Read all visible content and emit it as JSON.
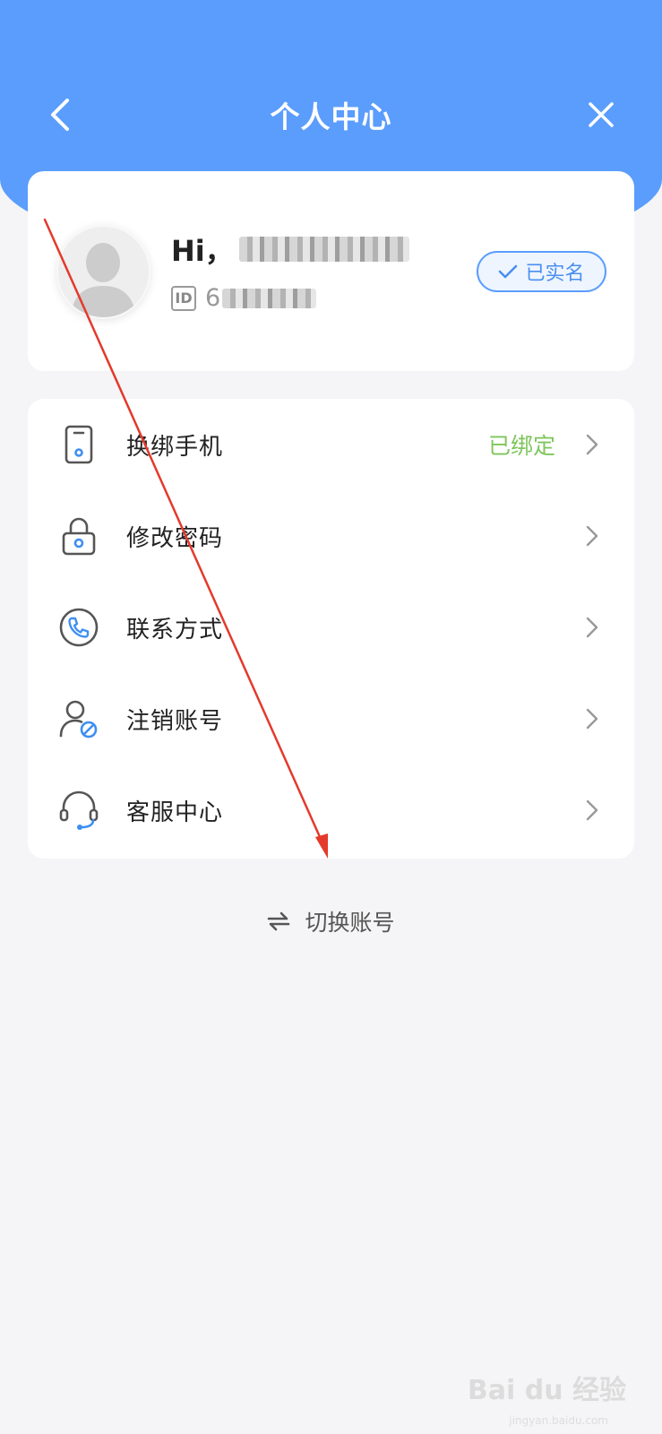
{
  "header": {
    "title": "个人中心",
    "background_color": "#5b9dfd"
  },
  "profile": {
    "greeting_prefix": "Hi，",
    "id_label": "ID",
    "id_value_visible": "6",
    "verified_label": "已实名"
  },
  "menu": {
    "items": [
      {
        "label": "换绑手机",
        "status": "已绑定",
        "icon": "phone-icon"
      },
      {
        "label": "修改密码",
        "status": "",
        "icon": "lock-icon"
      },
      {
        "label": "联系方式",
        "status": "",
        "icon": "phone-call-icon"
      },
      {
        "label": "注销账号",
        "status": "",
        "icon": "user-cancel-icon"
      },
      {
        "label": "客服中心",
        "status": "",
        "icon": "headset-icon"
      }
    ],
    "status_color": "#7ec65c"
  },
  "footer": {
    "switch_account_label": "切换账号"
  },
  "watermark": {
    "brand": "Bai du 经验",
    "sub": "jingyan.baidu.com"
  }
}
